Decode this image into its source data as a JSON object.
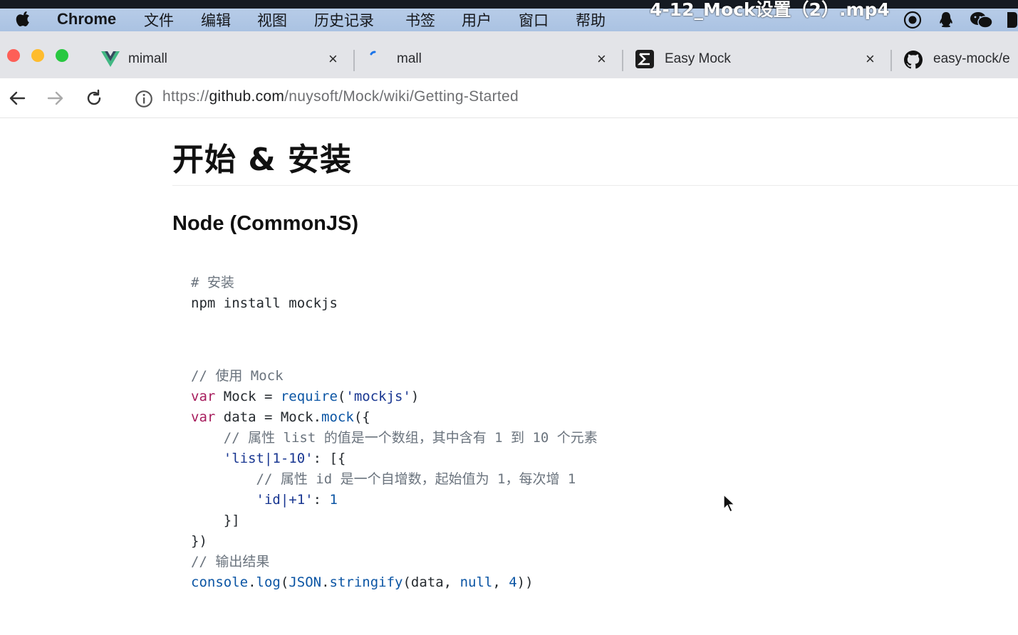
{
  "menubar": {
    "app_name": "Chrome",
    "items": [
      "文件",
      "编辑",
      "视图",
      "历史记录",
      "书签",
      "用户",
      "窗口",
      "帮助"
    ],
    "video_title": "4-12_Mock设置（2）.mp4"
  },
  "tabs": [
    {
      "label": "mimall",
      "icon": "vue-logo-icon"
    },
    {
      "label": "mall",
      "icon": "loading-spinner-icon"
    },
    {
      "label": "Easy Mock",
      "icon": "easy-mock-logo-icon"
    },
    {
      "label": "easy-mock/e",
      "icon": "github-icon"
    }
  ],
  "tab_close_glyph": "×",
  "address_bar": {
    "scheme": "https://",
    "host": "github.com",
    "path": "/nuysoft/Mock/wiki/Getting-Started"
  },
  "page": {
    "h1": "开始 & 安装",
    "h2": "Node (CommonJS)",
    "install_block": {
      "comment": "# 安装",
      "command": "npm install mockjs"
    },
    "usage_block": {
      "comment_use": "// 使用 Mock",
      "line_require_kw": "var",
      "line_require_mid": " Mock = ",
      "line_require_fn": "require",
      "line_require_open": "(",
      "line_require_str": "'mockjs'",
      "line_require_close": ")",
      "line_data_kw": "var",
      "line_data_mid": " data = Mock.",
      "line_data_fn": "mock",
      "line_data_open": "({",
      "comment_list": "    // 属性 list 的值是一个数组，其中含有 1 到 10 个元素",
      "list_key": "    'list|1-10'",
      "list_after": ": [{",
      "comment_id": "        // 属性 id 是一个自增数，起始值为 1，每次增 1",
      "id_key": "        'id|+1'",
      "id_colon": ": ",
      "id_value": "1",
      "close_inner": "    }]",
      "close_outer": "})",
      "comment_output": "// 输出结果",
      "log_obj": "console",
      "log_dot": ".",
      "log_fn": "log",
      "log_open": "(",
      "log_json": "JSON",
      "log_dot2": ".",
      "log_stringify": "stringify",
      "log_args1": "(data, ",
      "log_null": "null",
      "log_comma": ", ",
      "log_four": "4",
      "log_close": "))"
    }
  },
  "colors": {
    "menubar": "#aec5e4",
    "tabstrip": "#e3e4e8",
    "traffic_close": "#fd5f57",
    "traffic_min": "#febc2e",
    "traffic_max": "#28c840",
    "keyword": "#a71d5d",
    "function": "#0b55a4",
    "comment": "#6a737d"
  }
}
